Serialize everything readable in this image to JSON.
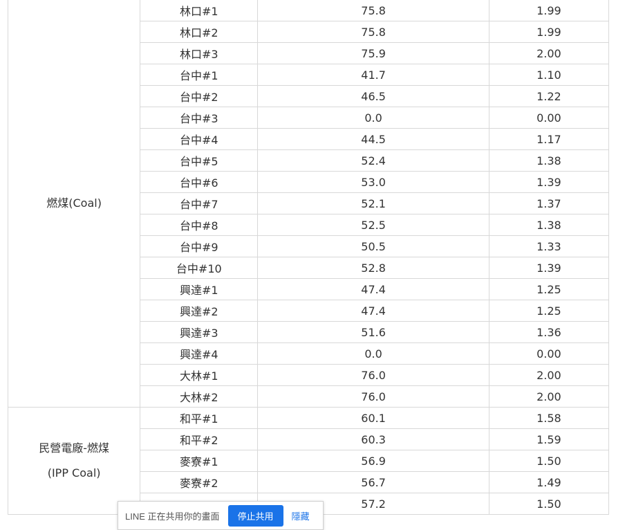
{
  "table": {
    "groups": [
      {
        "category": [
          "燃煤(Coal)"
        ],
        "rows": [
          {
            "unit": "林口#1",
            "net": "75.8",
            "ratio": "1.99"
          },
          {
            "unit": "林口#2",
            "net": "75.8",
            "ratio": "1.99"
          },
          {
            "unit": "林口#3",
            "net": "75.9",
            "ratio": "2.00"
          },
          {
            "unit": "台中#1",
            "net": "41.7",
            "ratio": "1.10"
          },
          {
            "unit": "台中#2",
            "net": "46.5",
            "ratio": "1.22"
          },
          {
            "unit": "台中#3",
            "net": "0.0",
            "ratio": "0.00"
          },
          {
            "unit": "台中#4",
            "net": "44.5",
            "ratio": "1.17"
          },
          {
            "unit": "台中#5",
            "net": "52.4",
            "ratio": "1.38"
          },
          {
            "unit": "台中#6",
            "net": "53.0",
            "ratio": "1.39"
          },
          {
            "unit": "台中#7",
            "net": "52.1",
            "ratio": "1.37"
          },
          {
            "unit": "台中#8",
            "net": "52.5",
            "ratio": "1.38"
          },
          {
            "unit": "台中#9",
            "net": "50.5",
            "ratio": "1.33"
          },
          {
            "unit": "台中#10",
            "net": "52.8",
            "ratio": "1.39"
          },
          {
            "unit": "興達#1",
            "net": "47.4",
            "ratio": "1.25"
          },
          {
            "unit": "興達#2",
            "net": "47.4",
            "ratio": "1.25"
          },
          {
            "unit": "興達#3",
            "net": "51.6",
            "ratio": "1.36"
          },
          {
            "unit": "興達#4",
            "net": "0.0",
            "ratio": "0.00"
          },
          {
            "unit": "大林#1",
            "net": "76.0",
            "ratio": "2.00"
          },
          {
            "unit": "大林#2",
            "net": "76.0",
            "ratio": "2.00"
          }
        ]
      },
      {
        "category": [
          "民營電廠-燃煤",
          "(IPP Coal)"
        ],
        "rows": [
          {
            "unit": "和平#1",
            "net": "60.1",
            "ratio": "1.58"
          },
          {
            "unit": "和平#2",
            "net": "60.3",
            "ratio": "1.59"
          },
          {
            "unit": "麥寮#1",
            "net": "56.9",
            "ratio": "1.50"
          },
          {
            "unit": "麥寮#2",
            "net": "56.7",
            "ratio": "1.49"
          },
          {
            "unit": "",
            "net": "57.2",
            "ratio": "1.50"
          }
        ]
      }
    ]
  },
  "popup": {
    "text": "LINE 正在共用你的畫面",
    "stop_label": "停止共用",
    "hide_label": "隱藏"
  },
  "colors": {
    "border": "#d8d8d8",
    "text": "#333333",
    "button": "#1a73e8"
  }
}
